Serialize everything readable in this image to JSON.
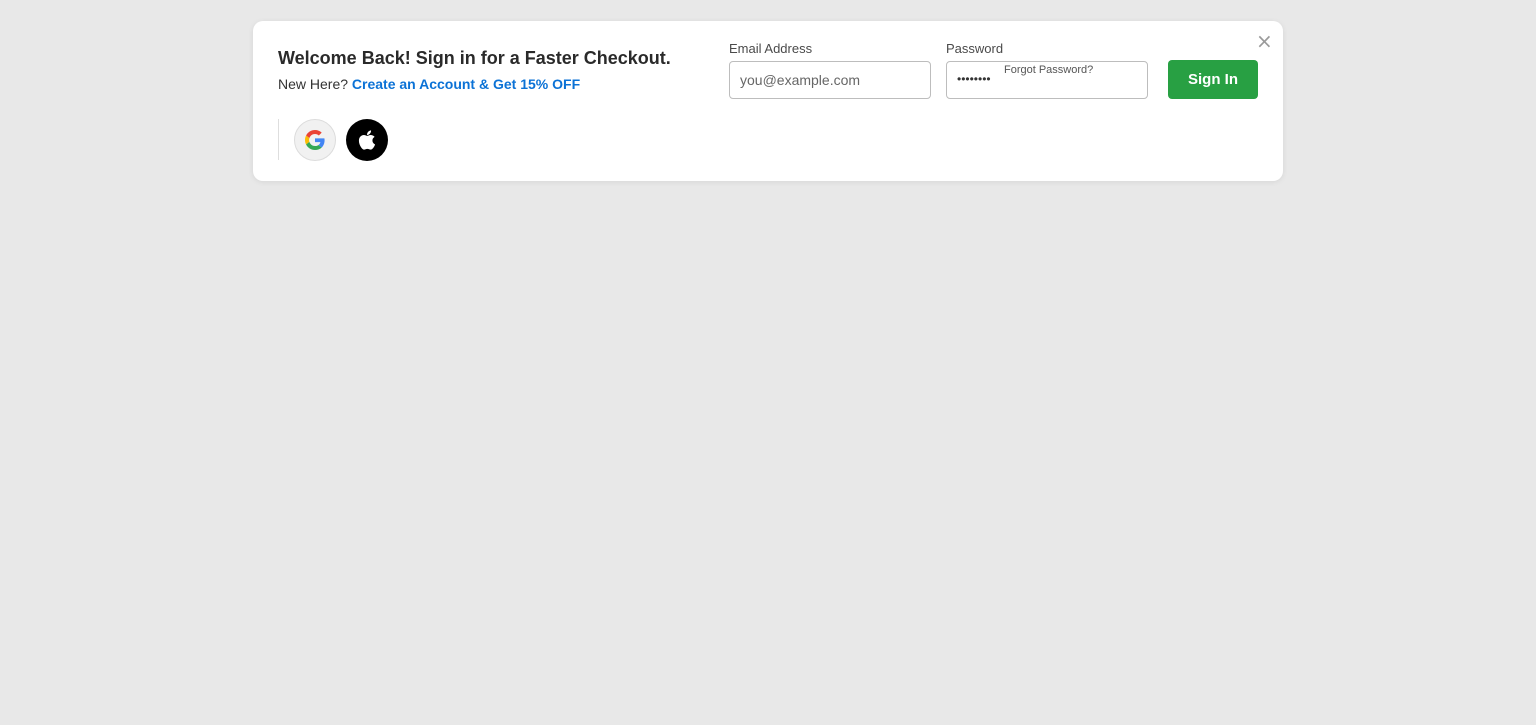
{
  "modal": {
    "headline": "Welcome Back! Sign in for a Faster Checkout.",
    "new_here_text": "New Here?",
    "create_account_link": "Create an Account & Get 15% OFF",
    "close_symbol": "×"
  },
  "social": {
    "google_icon": "google-logo",
    "apple_icon": "apple-logo"
  },
  "form": {
    "email_label": "Email Address",
    "email_placeholder": "you@example.com",
    "password_label": "Password",
    "password_masked": "••••••••",
    "forgot_password": "Forgot Password?",
    "signin_label": "Sign In"
  },
  "colors": {
    "page_background": "#e8e8e8",
    "link_blue": "#0b72d6",
    "signin_green": "#28a043"
  }
}
